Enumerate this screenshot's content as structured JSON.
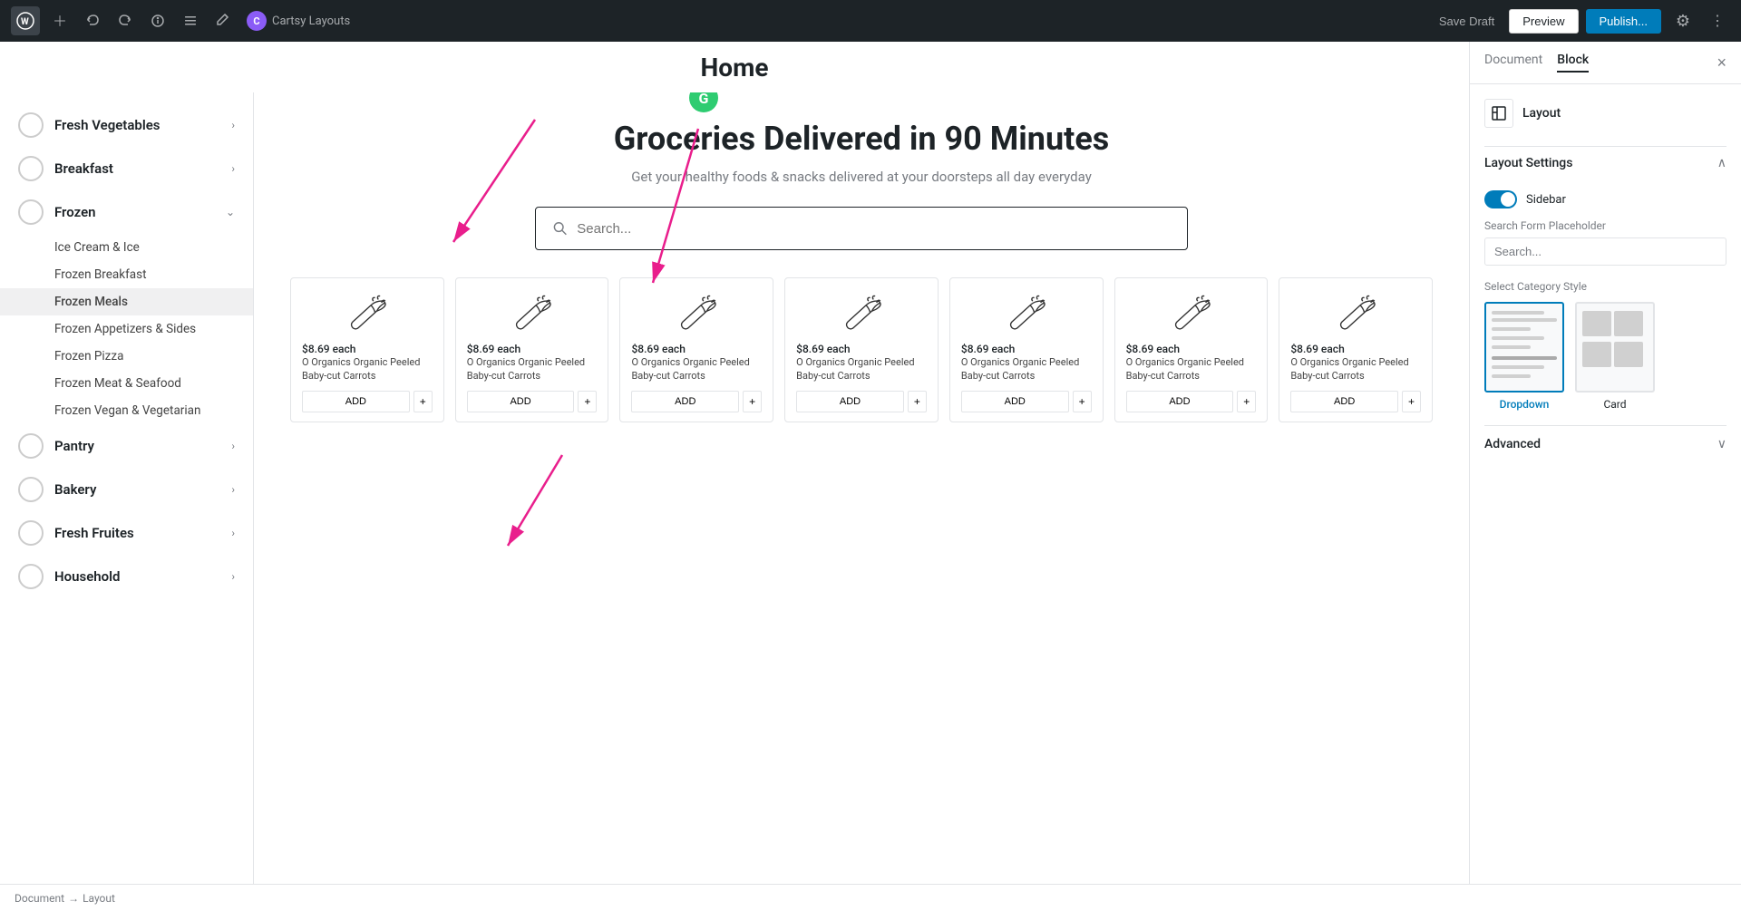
{
  "topbar": {
    "wp_logo": "W",
    "cartsy_label": "Cartsy Layouts",
    "cartsy_icon": "C",
    "save_draft_label": "Save Draft",
    "preview_label": "Preview",
    "publish_label": "Publish...",
    "settings_icon": "⚙",
    "more_icon": "⋮"
  },
  "editor": {
    "page_title": "Home",
    "hero_title": "Groceries Delivered in 90 Minutes",
    "hero_subtitle": "Get your healthy foods & snacks delivered at your doorsteps all day everyday",
    "search_placeholder": "Search..."
  },
  "nav": {
    "items": [
      {
        "label": "Fresh Vegetables",
        "has_arrow": true,
        "expanded": false
      },
      {
        "label": "Breakfast",
        "has_arrow": true,
        "expanded": false
      },
      {
        "label": "Frozen",
        "has_arrow": true,
        "expanded": true
      }
    ],
    "sub_items": [
      {
        "label": "Ice Cream & Ice",
        "active": false
      },
      {
        "label": "Frozen Breakfast",
        "active": false
      },
      {
        "label": "Frozen Meals",
        "active": true
      },
      {
        "label": "Frozen Appetizers & Sides",
        "active": false
      },
      {
        "label": "Frozen Pizza",
        "active": false
      },
      {
        "label": "Frozen Meat & Seafood",
        "active": false
      },
      {
        "label": "Frozen Vegan & Vegetarian",
        "active": false
      }
    ],
    "items2": [
      {
        "label": "Pantry",
        "has_arrow": true
      },
      {
        "label": "Bakery",
        "has_arrow": true
      },
      {
        "label": "Fresh Fruites",
        "has_arrow": true
      },
      {
        "label": "Household",
        "has_arrow": true
      }
    ]
  },
  "products": [
    {
      "price": "$8.69 each",
      "name": "O Organics Organic Peeled Baby-cut Carrots",
      "add": "ADD",
      "plus": "+"
    },
    {
      "price": "$8.69 each",
      "name": "O Organics Organic Peeled Baby-cut Carrots",
      "add": "ADD",
      "plus": "+"
    },
    {
      "price": "$8.69 each",
      "name": "O Organics Organic Peeled Baby-cut Carrots",
      "add": "ADD",
      "plus": "+"
    },
    {
      "price": "$8.69 each",
      "name": "O Organics Organic Peeled Baby-cut Carrots",
      "add": "ADD",
      "plus": "+"
    },
    {
      "price": "$8.69 each",
      "name": "O Organics Organic Peeled Baby-cut Carrots",
      "add": "ADD",
      "plus": "+"
    },
    {
      "price": "$8.69 each",
      "name": "O Organics Organic Peeled Baby-cut Carrots",
      "add": "ADD",
      "plus": "+"
    },
    {
      "price": "$8.69 each",
      "name": "O Organics Organic Peeled Baby-cut Carrots",
      "add": "ADD",
      "plus": "+"
    }
  ],
  "right_panel": {
    "tab_document": "Document",
    "tab_block": "Block",
    "close_icon": "×",
    "layout_label": "Layout",
    "layout_settings_title": "Layout Settings",
    "sidebar_label": "Sidebar",
    "search_placeholder_label": "Search Form Placeholder",
    "search_placeholder_value": "Search...",
    "category_style_label": "Select Category Style",
    "category_style_dropdown": "Dropdown",
    "category_style_card": "Card",
    "advanced_label": "Advanced"
  },
  "status_bar": {
    "breadcrumb1": "Document",
    "separator": "→",
    "breadcrumb2": "Layout"
  }
}
